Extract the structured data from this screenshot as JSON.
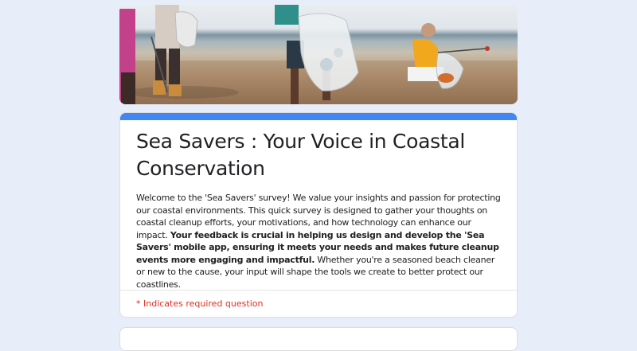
{
  "form": {
    "banner_image": "beach-cleanup-photo",
    "title": "Sea Savers : Your Voice in Coastal Conservation",
    "description_part1": "Welcome to the 'Sea Savers' survey! We value your insights and passion for protecting our coastal environments. This quick survey is designed to gather your thoughts on coastal cleanup efforts, your motivations, and how technology can enhance our impact. ",
    "description_bold": "Your feedback is crucial in helping us design and develop the 'Sea Savers' mobile app, ensuring it meets your needs and makes future cleanup events more engaging and impactful.",
    "description_part2": " Whether you're a seasoned beach cleaner or new to the cause, your input will shape the tools we create to better protect our coastlines.",
    "required_note": "* Indicates required question"
  },
  "colors": {
    "accent": "#4285f4",
    "page_bg": "#e8eef9",
    "required": "#d93025"
  }
}
